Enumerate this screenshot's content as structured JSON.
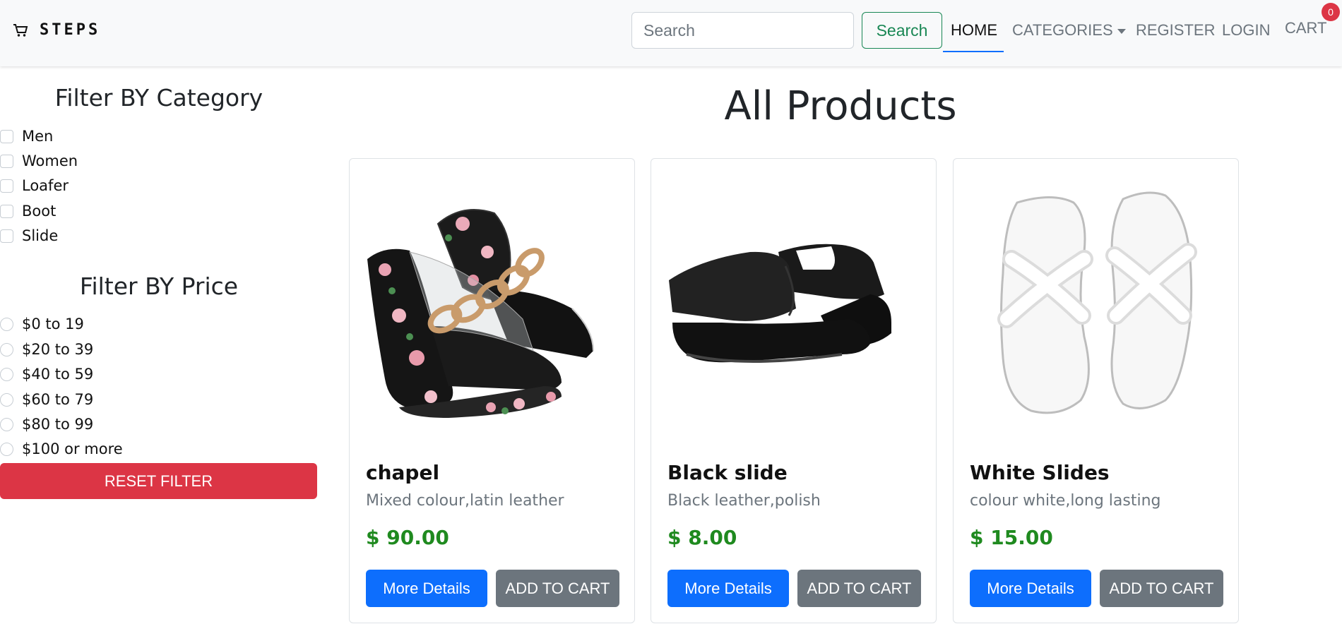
{
  "navbar": {
    "brand": "STEPS",
    "brand_icon": "cart-icon",
    "search_placeholder": "Search",
    "search_button": "Search",
    "links": {
      "home": "HOME",
      "categories": "CATEGORIES",
      "register": "REGISTER",
      "login": "LOGIN",
      "cart": "CART"
    },
    "cart_count": "0"
  },
  "sidebar": {
    "category_title": "Filter BY Category",
    "categories": [
      "Men",
      "Women",
      "Loafer",
      "Boot",
      "Slide"
    ],
    "price_title": "Filter BY Price",
    "prices": [
      "$0 to 19",
      "$20 to 39",
      "$40 to 59",
      "$60 to 79",
      "$80 to 99",
      "$100 or more"
    ],
    "reset_button": "RESET FILTER"
  },
  "main": {
    "title": "All Products",
    "products": [
      {
        "name": "chapel",
        "description": "Mixed colour,latin leather",
        "price": "$ 90.00",
        "details_button": "More Details",
        "cart_button": "ADD TO CART"
      },
      {
        "name": "Black slide",
        "description": "Black leather,polish",
        "price": "$ 8.00",
        "details_button": "More Details",
        "cart_button": "ADD TO CART"
      },
      {
        "name": "White Slides",
        "description": "colour white,long lasting",
        "price": "$ 15.00",
        "details_button": "More Details",
        "cart_button": "ADD TO CART"
      }
    ]
  },
  "colors": {
    "primary": "#0d6efd",
    "secondary": "#6c757d",
    "danger": "#dc3545",
    "success": "#198754",
    "price": "#1f8a1f"
  }
}
